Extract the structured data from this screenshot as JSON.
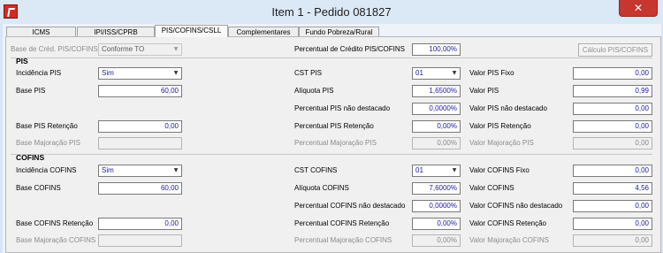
{
  "window": {
    "title": "Item 1 - Pedido 081827",
    "close_glyph": "✕"
  },
  "tabs": [
    {
      "label": "ICMS",
      "active": false
    },
    {
      "label": "IPI/ISS/CPRB",
      "active": false
    },
    {
      "label": "PIS/COFINS/CSLL",
      "active": true
    },
    {
      "label": "Complementares",
      "active": false
    },
    {
      "label": "Fundo Pobreza/Rural",
      "active": false
    }
  ],
  "top": {
    "base_cred_label": "Base de Créd. PIS/COFINS",
    "base_cred_value": "Conforme TO",
    "percent_cred_label": "Percentual de Crédito PIS/COFINS",
    "percent_cred_value": "100,00%",
    "calc_button_label": "Cálculo PIS/COFINS"
  },
  "pis": {
    "title": "PIS",
    "incidencia_label": "Incidência PIS",
    "incidencia_value": "Sim",
    "base_label": "Base PIS",
    "base_value": "60,00",
    "base_ret_label": "Base PIS Retenção",
    "base_ret_value": "0,00",
    "base_maj_label": "Base Majoração PIS",
    "base_maj_value": "",
    "cst_label": "CST PIS",
    "cst_value": "01",
    "aliquota_label": "Alíquota PIS",
    "aliquota_value": "1,6500%",
    "perc_nao_dest_label": "Percentual PIS não destacado",
    "perc_nao_dest_value": "0,0000%",
    "perc_ret_label": "Percentual PIS Retenção",
    "perc_ret_value": "0,00%",
    "perc_maj_label": "Percentual Majoração PIS",
    "perc_maj_value": "0,00%",
    "valor_fixo_label": "Valor PIS Fixo",
    "valor_fixo_value": "0,00",
    "valor_label": "Valor PIS",
    "valor_value": "0,99",
    "valor_nao_dest_label": "Valor PIS não destacado",
    "valor_nao_dest_value": "0,00",
    "valor_ret_label": "Valor PIS Retenção",
    "valor_ret_value": "0,00",
    "valor_maj_label": "Valor Majoração PIS",
    "valor_maj_value": "0,00"
  },
  "cofins": {
    "title": "COFINS",
    "incidencia_label": "Incidência COFINS",
    "incidencia_value": "Sim",
    "base_label": "Base COFINS",
    "base_value": "60,00",
    "base_ret_label": "Base COFINS Retenção",
    "base_ret_value": "0,00",
    "base_maj_label": "Base Majoração COFINS",
    "base_maj_value": "",
    "cst_label": "CST COFINS",
    "cst_value": "01",
    "aliquota_label": "Alíquota COFINS",
    "aliquota_value": "7,6000%",
    "perc_nao_dest_label": "Percentual COFINS não destacado",
    "perc_nao_dest_value": "0,0000%",
    "perc_ret_label": "Percentual COFINS Retenção",
    "perc_ret_value": "0,00%",
    "perc_maj_label": "Percentual Majoração COFINS",
    "perc_maj_value": "0,00%",
    "valor_fixo_label": "Valor COFINS Fixo",
    "valor_fixo_value": "0,00",
    "valor_label": "Valor COFINS",
    "valor_value": "4,56",
    "valor_nao_dest_label": "Valor COFINS não destacado",
    "valor_nao_dest_value": "0,00",
    "valor_ret_label": "Valor COFINS Retenção",
    "valor_ret_value": "0,00",
    "valor_maj_label": "Valor Majoração COFINS",
    "valor_maj_value": "0,00"
  }
}
